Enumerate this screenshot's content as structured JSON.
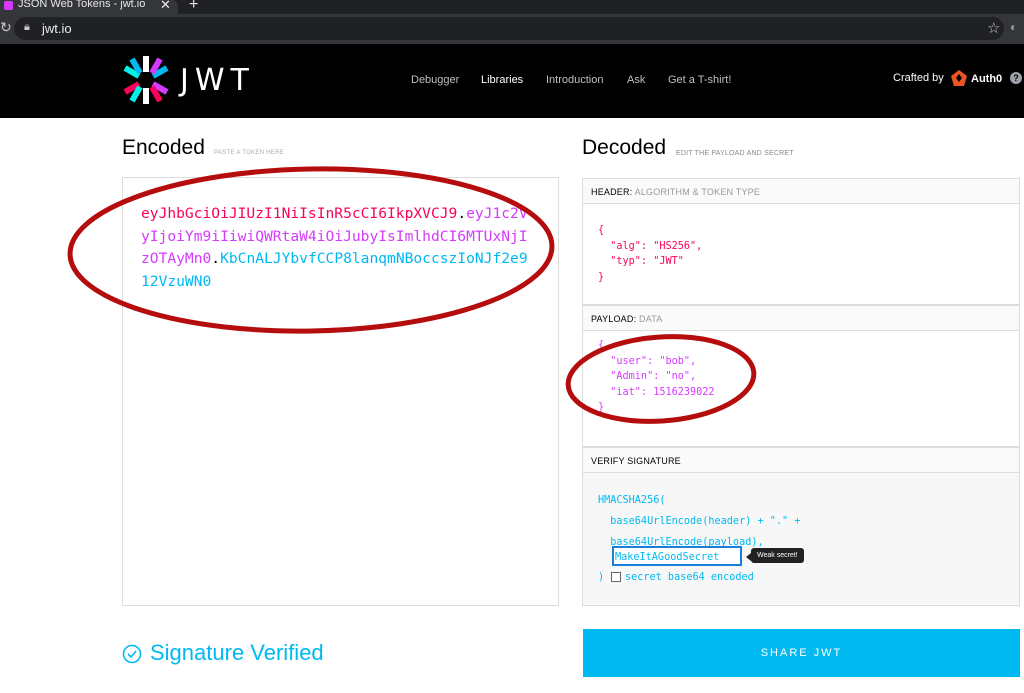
{
  "browser": {
    "tab_title": "JSON Web Tokens - jwt.io",
    "tab_close": "✕",
    "new_tab": "+",
    "url": "jwt.io"
  },
  "header": {
    "logo_text": "JWT",
    "nav": [
      "Debugger",
      "Libraries",
      "Introduction",
      "Ask",
      "Get a T-shirt!"
    ],
    "active_nav": "Libraries",
    "crafted_by": "Crafted by",
    "brand": "Auth0",
    "help": "?"
  },
  "encoded": {
    "title": "Encoded",
    "hint": "PASTE A TOKEN HERE",
    "token_header": "eyJhbGciOiJIUzI1NiIsInR5cCI6IkpXVCJ9",
    "dot1": ".",
    "token_payload": "eyJ1c2VyIjoiYm9iIiwiQWRtaW4iOiJubyIsImlhdCI6MTUxNjIzOTAyMn0",
    "dot2": ".",
    "token_signature": "KbCnALJYbvfCCP8lanqmNBoccszIoNJf2e912VzuWN0"
  },
  "status": {
    "verified": "Signature Verified"
  },
  "decoded": {
    "title": "Decoded",
    "hint": "EDIT THE PAYLOAD AND SECRET",
    "header_section": {
      "label": "HEADER:",
      "sub": "ALGORITHM & TOKEN TYPE"
    },
    "header_json": "{\n  \"alg\": \"HS256\",\n  \"typ\": \"JWT\"\n}",
    "payload_section": {
      "label": "PAYLOAD:",
      "sub": "DATA"
    },
    "payload_json": "{\n  \"user\": \"bob\",\n  \"Admin\": \"no\",\n  \"iat\": 1516239022\n}",
    "verify_section": {
      "label": "VERIFY SIGNATURE"
    },
    "verify_code": "HMACSHA256(\n  base64UrlEncode(header) + \".\" +\n  base64UrlEncode(payload),",
    "secret_value": "MakeItAGoodSecret",
    "weak_tooltip": "Weak secret!",
    "close_paren": ")",
    "b64_label": "secret base64 encoded"
  },
  "share_label": "SHARE JWT",
  "colors": {
    "header": "#fb015b",
    "payload": "#d63aff",
    "signature": "#00b9f1",
    "annotation": "#b50d0d"
  }
}
